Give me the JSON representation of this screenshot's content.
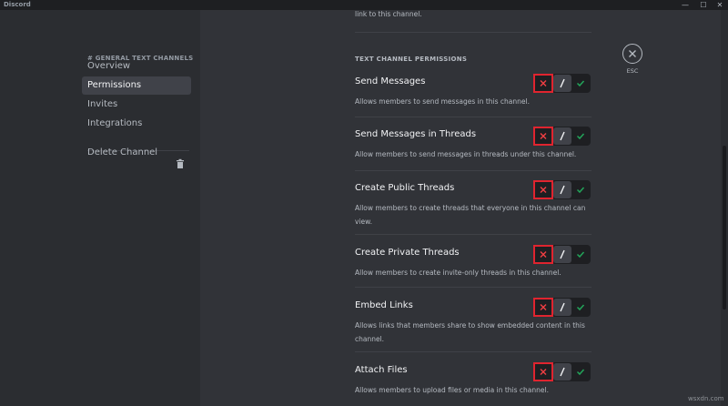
{
  "app": {
    "title": "Discord"
  },
  "window_controls": {
    "minimize": "—",
    "maximize": "☐",
    "close": "✕"
  },
  "sidebar": {
    "header": "# GENERAL TEXT CHANNELS",
    "items": [
      {
        "label": "Overview",
        "active": false
      },
      {
        "label": "Permissions",
        "active": true
      },
      {
        "label": "Invites",
        "active": false
      },
      {
        "label": "Integrations",
        "active": false
      }
    ],
    "delete_label": "Delete Channel"
  },
  "main": {
    "top_text": "link to this channel.",
    "section_title": "TEXT CHANNEL PERMISSIONS",
    "permissions": [
      {
        "name": "Send Messages",
        "description": "Allows members to send messages in this channel.",
        "state": "deny"
      },
      {
        "name": "Send Messages in Threads",
        "description": "Allow members to send messages in threads under this channel.",
        "state": "deny"
      },
      {
        "name": "Create Public Threads",
        "description": "Allow members to create threads that everyone in this channel can view.",
        "state": "deny"
      },
      {
        "name": "Create Private Threads",
        "description": "Allow members to create invite-only threads in this channel.",
        "state": "deny"
      },
      {
        "name": "Embed Links",
        "description": "Allows links that members share to show embedded content in this channel.",
        "state": "deny"
      },
      {
        "name": "Attach Files",
        "description": "Allows members to upload files or media in this channel.",
        "state": "deny"
      }
    ]
  },
  "close": {
    "label": "ESC"
  },
  "watermark": "wsxdn.com",
  "colors": {
    "accent_deny": "#e0242f",
    "allow": "#23a55a",
    "background": "#313338",
    "sidebar": "#2b2d31"
  }
}
